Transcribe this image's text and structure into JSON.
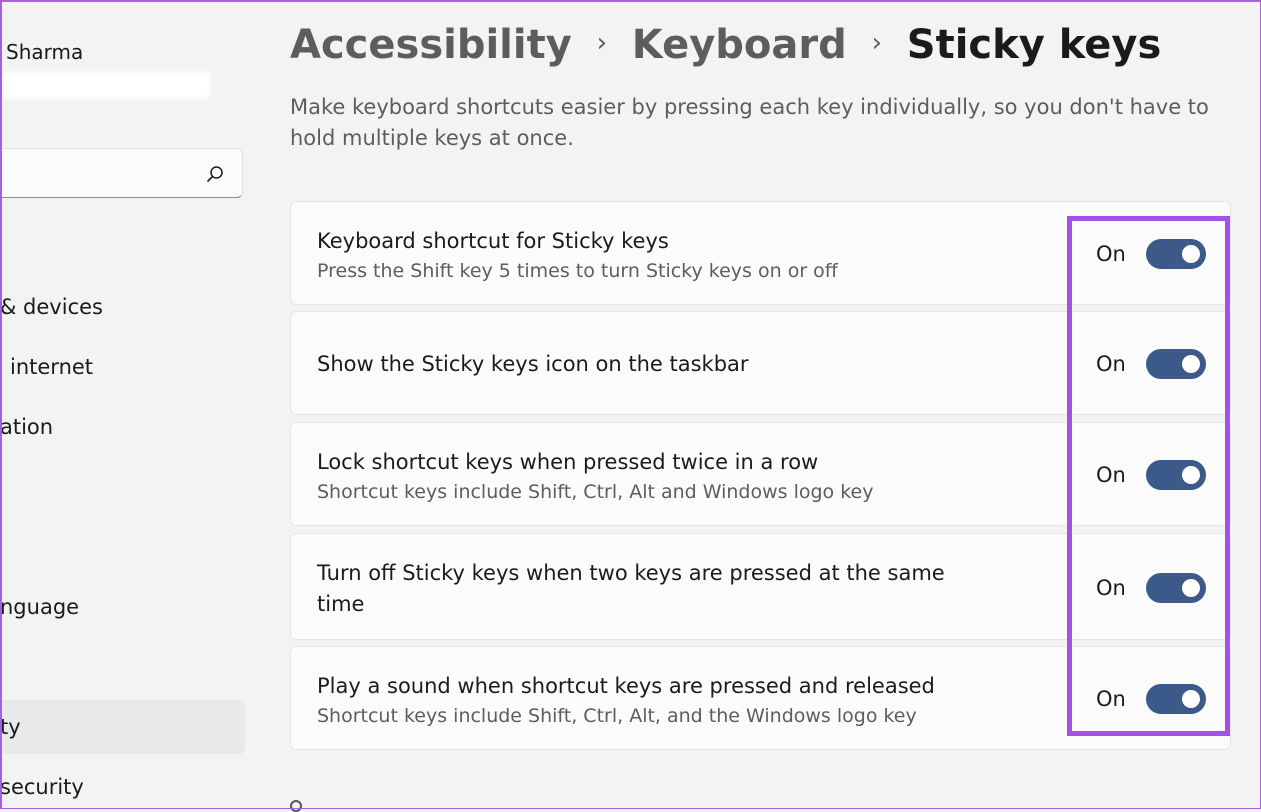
{
  "sidebar": {
    "user_name": "Sharma",
    "items": [
      {
        "label": "& devices"
      },
      {
        "label": "internet"
      },
      {
        "label": "ation"
      },
      {
        "label": "nguage"
      },
      {
        "label": "ty"
      },
      {
        "label": "security"
      }
    ],
    "selected_index": 4
  },
  "search": {
    "placeholder": "",
    "icon": "search-icon"
  },
  "header": {
    "breadcrumb": [
      "Accessibility",
      "Keyboard",
      "Sticky keys"
    ],
    "separator": "›",
    "description": "Make keyboard shortcuts easier by pressing each key individually, so you don't have to hold multiple keys at once."
  },
  "settings": [
    {
      "title": "Keyboard shortcut for Sticky keys",
      "subtitle": "Press the Shift key 5 times to turn Sticky keys on or off",
      "state_label": "On",
      "enabled": true
    },
    {
      "title": "Show the Sticky keys icon on the taskbar",
      "subtitle": "",
      "state_label": "On",
      "enabled": true
    },
    {
      "title": "Lock shortcut keys when pressed twice in a row",
      "subtitle": "Shortcut keys include Shift, Ctrl, Alt and Windows logo key",
      "state_label": "On",
      "enabled": true
    },
    {
      "title": "Turn off Sticky keys when two keys are pressed at the same time",
      "subtitle": "",
      "state_label": "On",
      "enabled": true
    },
    {
      "title": "Play a sound when shortcut keys are pressed and released",
      "subtitle": "Shortcut keys include Shift, Ctrl, Alt, and the Windows logo key",
      "state_label": "On",
      "enabled": true
    }
  ],
  "colors": {
    "accent": "#3b5a89",
    "highlight": "#a551e8",
    "background": "#f3f3f3",
    "card": "#fbfbfb"
  }
}
